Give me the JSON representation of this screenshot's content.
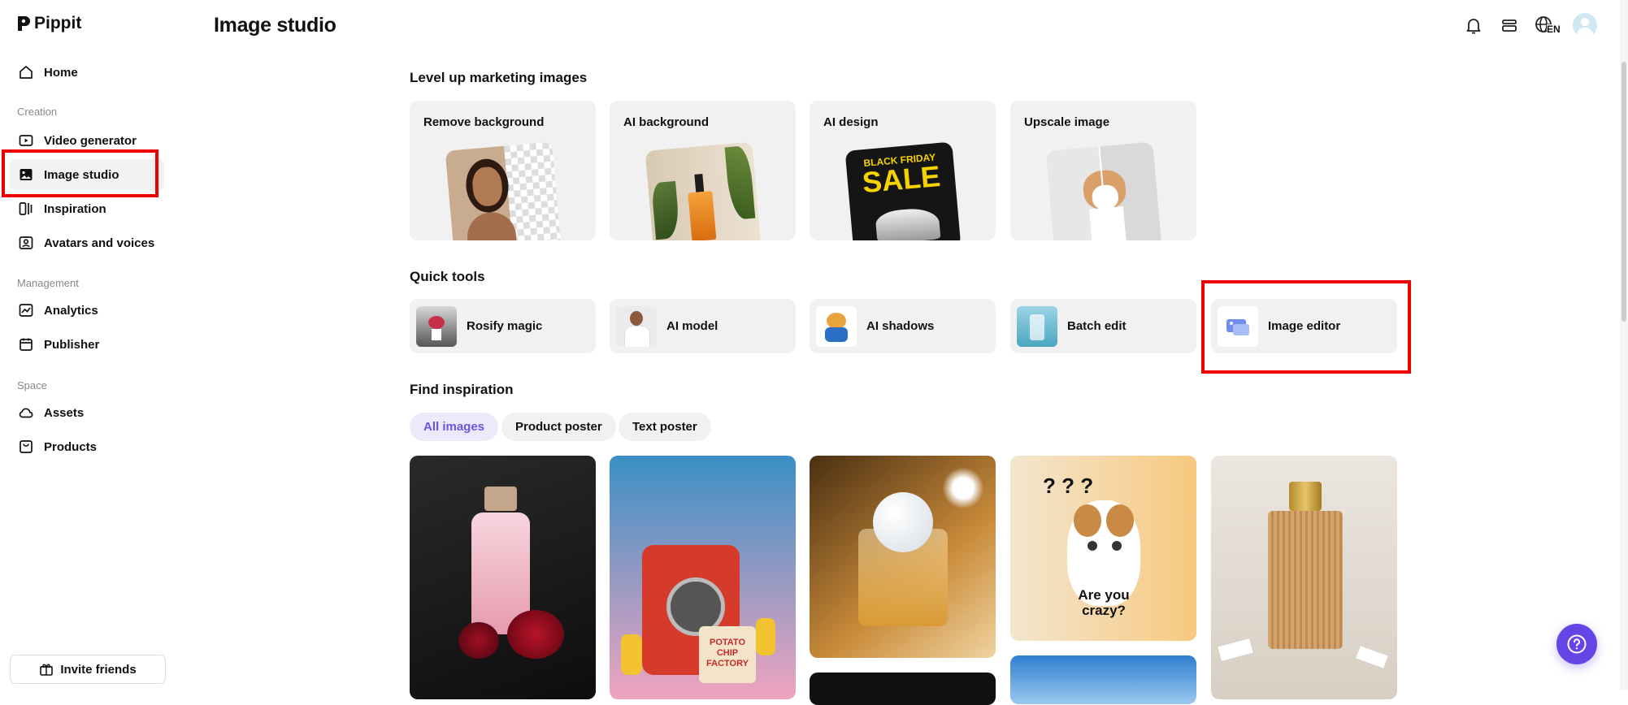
{
  "app": {
    "name": "Pippit"
  },
  "sidebar": {
    "home": "Home",
    "sections": [
      "Creation",
      "Management",
      "Space"
    ],
    "creation": [
      "Video generator",
      "Image studio",
      "Inspiration",
      "Avatars and voices"
    ],
    "management": [
      "Analytics",
      "Publisher"
    ],
    "space": [
      "Assets",
      "Products"
    ],
    "invite": "Invite friends"
  },
  "header": {
    "title": "Image studio",
    "language": "EN"
  },
  "marketing": {
    "heading": "Level up marketing images",
    "cards": [
      "Remove background",
      "AI background",
      "AI design",
      "Upscale image"
    ],
    "sale_text_1": "BLACK FRIDAY",
    "sale_text_2": "SALE"
  },
  "quick_tools": {
    "heading": "Quick tools",
    "items": [
      "Rosify magic",
      "AI model",
      "AI shadows",
      "Batch edit",
      "Image editor"
    ]
  },
  "inspiration": {
    "heading": "Find inspiration",
    "filters": [
      "All images",
      "Product poster",
      "Text poster"
    ],
    "active_filter": "All images",
    "chip_bag_text": "POTATO CHIP FACTORY",
    "cat_text": "Are you crazy?"
  },
  "colors": {
    "accent": "#6446e6",
    "highlight": "#e00000",
    "chip_active_bg": "#ece9fb"
  }
}
